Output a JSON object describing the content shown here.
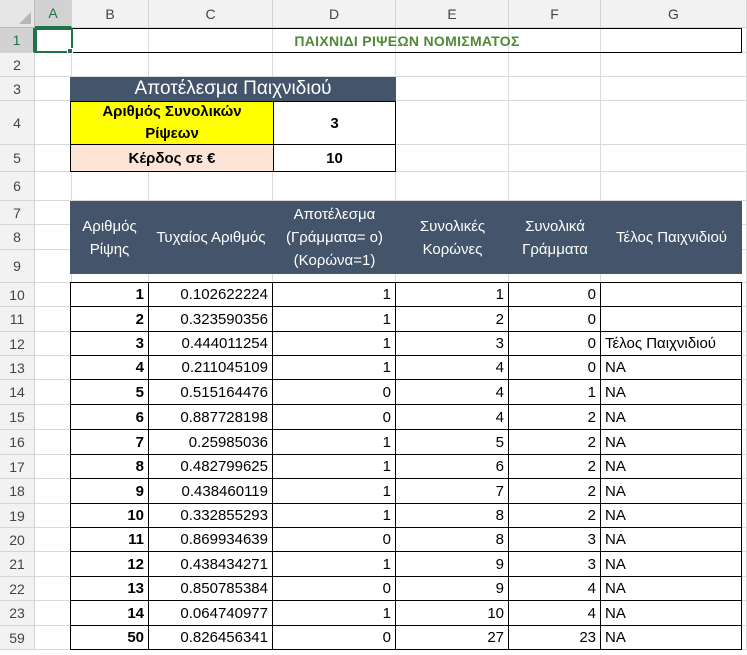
{
  "sheet": {
    "columns": [
      "A",
      "B",
      "C",
      "D",
      "E",
      "F",
      "G"
    ],
    "row_numbers": [
      "1",
      "2",
      "3",
      "4",
      "5",
      "6",
      "7",
      "8",
      "9",
      "10",
      "11",
      "12",
      "13",
      "14",
      "15",
      "16",
      "17",
      "18",
      "19",
      "20",
      "21",
      "22",
      "23",
      "59"
    ]
  },
  "title": "ΠΑΙΧΝΙΔΙ ΡΙΨΕΩΝ ΝΟΜΙΣΜΑΤΟΣ",
  "result_box": {
    "header": "Αποτέλεσμα Παιχνιδιού",
    "total_tosses_label": "Αριθμός Συνολικών Ρίψεων",
    "total_tosses_value": "3",
    "profit_label": "Κέρδος σε €",
    "profit_value": "10"
  },
  "table": {
    "headers": [
      "Αριθμός Ρίψης",
      "Τυχαίος Αριθμός",
      "Αποτέλεσμα (Γράμματα= ο) (Κορώνα=1)",
      "Συνολικές Κορώνες",
      "Συνολικά Γράμματα",
      "Τέλος Παιχνιδιού"
    ],
    "rows": [
      [
        "1",
        "0.102622224",
        "1",
        "1",
        "0",
        ""
      ],
      [
        "2",
        "0.323590356",
        "1",
        "2",
        "0",
        ""
      ],
      [
        "3",
        "0.444011254",
        "1",
        "3",
        "0",
        "Τέλος Παιχνιδιού"
      ],
      [
        "4",
        "0.211045109",
        "1",
        "4",
        "0",
        "NA"
      ],
      [
        "5",
        "0.515164476",
        "0",
        "4",
        "1",
        "NA"
      ],
      [
        "6",
        "0.887728198",
        "0",
        "4",
        "2",
        "NA"
      ],
      [
        "7",
        "0.25985036",
        "1",
        "5",
        "2",
        "NA"
      ],
      [
        "8",
        "0.482799625",
        "1",
        "6",
        "2",
        "NA"
      ],
      [
        "9",
        "0.438460119",
        "1",
        "7",
        "2",
        "NA"
      ],
      [
        "10",
        "0.332855293",
        "1",
        "8",
        "2",
        "NA"
      ],
      [
        "11",
        "0.869934639",
        "0",
        "8",
        "3",
        "NA"
      ],
      [
        "12",
        "0.438434271",
        "1",
        "9",
        "3",
        "NA"
      ],
      [
        "13",
        "0.850785384",
        "0",
        "9",
        "4",
        "NA"
      ],
      [
        "14",
        "0.064740977",
        "1",
        "10",
        "4",
        "NA"
      ],
      [
        "50",
        "0.826456341",
        "0",
        "27",
        "23",
        "NA"
      ]
    ]
  }
}
